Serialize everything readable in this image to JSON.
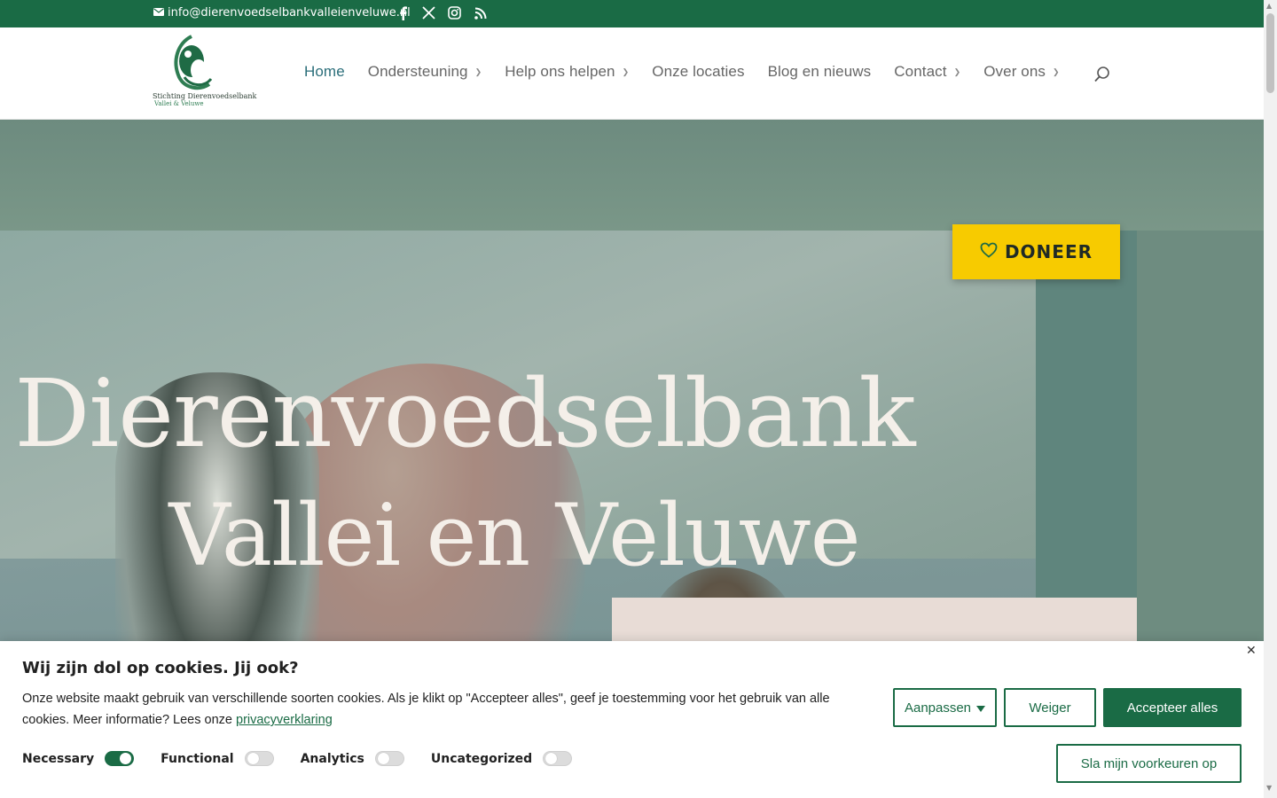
{
  "topbar": {
    "email": "info@dierenvoedselbankvalleienveluwe.nl",
    "social": [
      "facebook-icon",
      "x-icon",
      "instagram-icon",
      "rss-icon"
    ],
    "bg_color": "#1a6b45"
  },
  "logo": {
    "line1": "Stichting Dierenvoedselbank",
    "line2": "Vallei & Veluwe"
  },
  "nav": {
    "items": [
      {
        "label": "Home",
        "active": true,
        "dropdown": false
      },
      {
        "label": "Ondersteuning",
        "dropdown": true
      },
      {
        "label": "Help ons helpen",
        "dropdown": true
      },
      {
        "label": "Onze locaties",
        "dropdown": false
      },
      {
        "label": "Blog en nieuws",
        "dropdown": false
      },
      {
        "label": "Contact",
        "dropdown": true
      },
      {
        "label": "Over ons",
        "dropdown": true
      }
    ],
    "active_color": "#2b6e7a"
  },
  "hero": {
    "title_line1": "Dierenvoedselbank",
    "title_line2": "Vallei en Veluwe",
    "donate_label": "DONEER",
    "donate_color": "#f7cb00"
  },
  "cookie": {
    "title": "Wij zijn dol op cookies. Jij ook?",
    "text": "Onze website maakt gebruik van verschillende soorten cookies. Als je klikt op \"Accepteer alles\", geef je toestemming voor het gebruik van alle cookies. Meer informatie? Lees onze",
    "link": "privacyverklaring",
    "buttons": {
      "customize": "Aanpassen",
      "reject": "Weiger",
      "accept": "Accepteer alles",
      "save": "Sla mijn voorkeuren op"
    },
    "toggles": [
      {
        "label": "Necessary",
        "on": true
      },
      {
        "label": "Functional",
        "on": false
      },
      {
        "label": "Analytics",
        "on": false
      },
      {
        "label": "Uncategorized",
        "on": false
      }
    ]
  }
}
